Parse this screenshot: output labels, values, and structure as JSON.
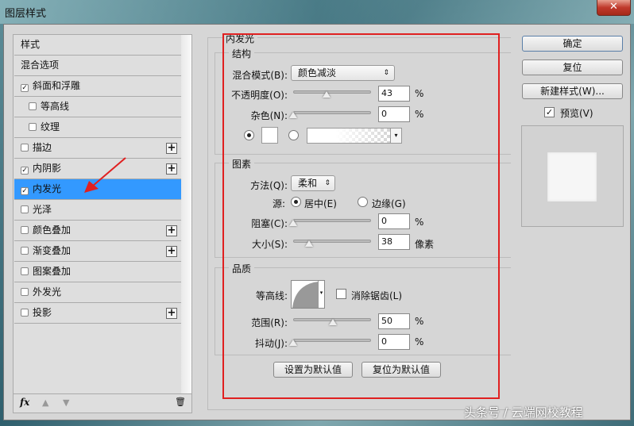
{
  "window": {
    "title": "图层样式",
    "close": "✕"
  },
  "sidebar": {
    "items": [
      {
        "label": "样式",
        "checkbox": false,
        "checked": false,
        "plus": false,
        "indent": false
      },
      {
        "label": "混合选项",
        "checkbox": false,
        "checked": false,
        "plus": false,
        "indent": false
      },
      {
        "label": "斜面和浮雕",
        "checkbox": true,
        "checked": true,
        "plus": false,
        "indent": false
      },
      {
        "label": "等高线",
        "checkbox": true,
        "checked": false,
        "plus": false,
        "indent": true
      },
      {
        "label": "纹理",
        "checkbox": true,
        "checked": false,
        "plus": false,
        "indent": true
      },
      {
        "label": "描边",
        "checkbox": true,
        "checked": false,
        "plus": true,
        "indent": false
      },
      {
        "label": "内阴影",
        "checkbox": true,
        "checked": true,
        "plus": true,
        "indent": false
      },
      {
        "label": "内发光",
        "checkbox": true,
        "checked": true,
        "plus": false,
        "indent": false,
        "selected": true
      },
      {
        "label": "光泽",
        "checkbox": true,
        "checked": false,
        "plus": false,
        "indent": false
      },
      {
        "label": "颜色叠加",
        "checkbox": true,
        "checked": false,
        "plus": true,
        "indent": false
      },
      {
        "label": "渐变叠加",
        "checkbox": true,
        "checked": false,
        "plus": true,
        "indent": false
      },
      {
        "label": "图案叠加",
        "checkbox": true,
        "checked": false,
        "plus": false,
        "indent": false
      },
      {
        "label": "外发光",
        "checkbox": true,
        "checked": false,
        "plus": false,
        "indent": false
      },
      {
        "label": "投影",
        "checkbox": true,
        "checked": false,
        "plus": true,
        "indent": false
      }
    ],
    "footer": {
      "fx": "fx",
      "up": "▲",
      "down": "▼",
      "trash": "🗑"
    }
  },
  "panel": {
    "title": "内发光",
    "structure": {
      "title": "结构",
      "blend_label": "混合模式(B):",
      "blend_value": "颜色减淡",
      "opacity_label": "不透明度(O):",
      "opacity": "43",
      "opacity_unit": "%",
      "noise_label": "杂色(N):",
      "noise": "0",
      "noise_unit": "%"
    },
    "elements": {
      "title": "图素",
      "method_label": "方法(Q):",
      "method_value": "柔和",
      "source_label": "源:",
      "center": "居中(E)",
      "edge": "边缘(G)",
      "choke_label": "阻塞(C):",
      "choke": "0",
      "choke_unit": "%",
      "size_label": "大小(S):",
      "size": "38",
      "size_unit": "像素"
    },
    "quality": {
      "title": "品质",
      "contour_label": "等高线:",
      "antialias": "消除锯齿(L)",
      "range_label": "范围(R):",
      "range": "50",
      "range_unit": "%",
      "jitter_label": "抖动(J):",
      "jitter": "0",
      "jitter_unit": "%"
    },
    "set_default": "设置为默认值",
    "reset_default": "复位为默认值"
  },
  "right": {
    "ok": "确定",
    "reset": "复位",
    "new_style": "新建样式(W)...",
    "preview": "预览(V)"
  },
  "watermark": "头条号 / 云端网校教程",
  "colors": {
    "selected": "#3399ff",
    "annotation": "#e02020"
  }
}
